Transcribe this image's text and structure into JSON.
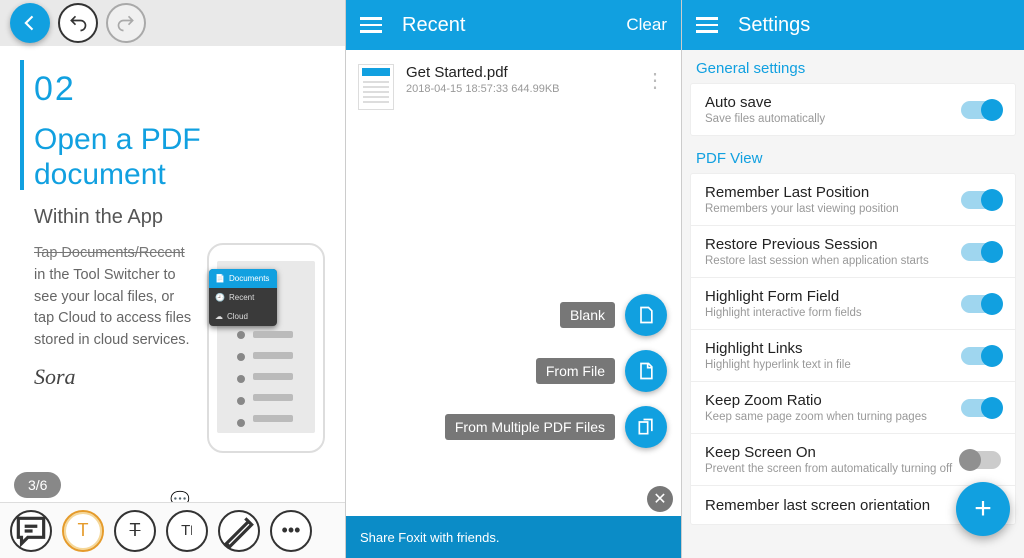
{
  "panel1": {
    "page_number": "02",
    "title": "Open a PDF document",
    "subtitle": "Within the App",
    "tap_line": "Tap Documents/Recent",
    "body": "in  the Tool Switcher to see your local files, or tap Cloud to access files stored in cloud services.",
    "menu": {
      "documents": "Documents",
      "recent": "Recent",
      "cloud": "Cloud"
    },
    "signature": "Sora",
    "page_indicator": "3/6",
    "tools": [
      "comment",
      "highlight",
      "strikeout",
      "text",
      "draw",
      "more"
    ]
  },
  "panel2": {
    "header": "Recent",
    "clear": "Clear",
    "file": {
      "name": "Get Started.pdf",
      "meta": "2018-04-15 18:57:33  644.99KB"
    },
    "fabs": {
      "blank": "Blank",
      "from_file": "From File",
      "from_multiple": "From Multiple PDF Files"
    },
    "share_text": "Share Foxit with friends."
  },
  "panel3": {
    "header": "Settings",
    "sections": {
      "general": {
        "label": "General settings",
        "items": [
          {
            "title": "Auto save",
            "desc": "Save files automatically",
            "on": true
          }
        ]
      },
      "pdfview": {
        "label": "PDF View",
        "items": [
          {
            "title": "Remember Last Position",
            "desc": "Remembers your last viewing position",
            "on": true
          },
          {
            "title": "Restore Previous Session",
            "desc": "Restore last session when application starts",
            "on": true
          },
          {
            "title": "Highlight Form Field",
            "desc": "Highlight interactive form fields",
            "on": true
          },
          {
            "title": "Highlight Links",
            "desc": "Highlight hyperlink text in file",
            "on": true
          },
          {
            "title": "Keep Zoom Ratio",
            "desc": "Keep same page zoom when turning pages",
            "on": true
          },
          {
            "title": "Keep Screen On",
            "desc": "Prevent the screen from automatically turning off",
            "on": false
          },
          {
            "title": "Remember last screen orientation",
            "desc": "",
            "on": true
          }
        ]
      }
    }
  }
}
